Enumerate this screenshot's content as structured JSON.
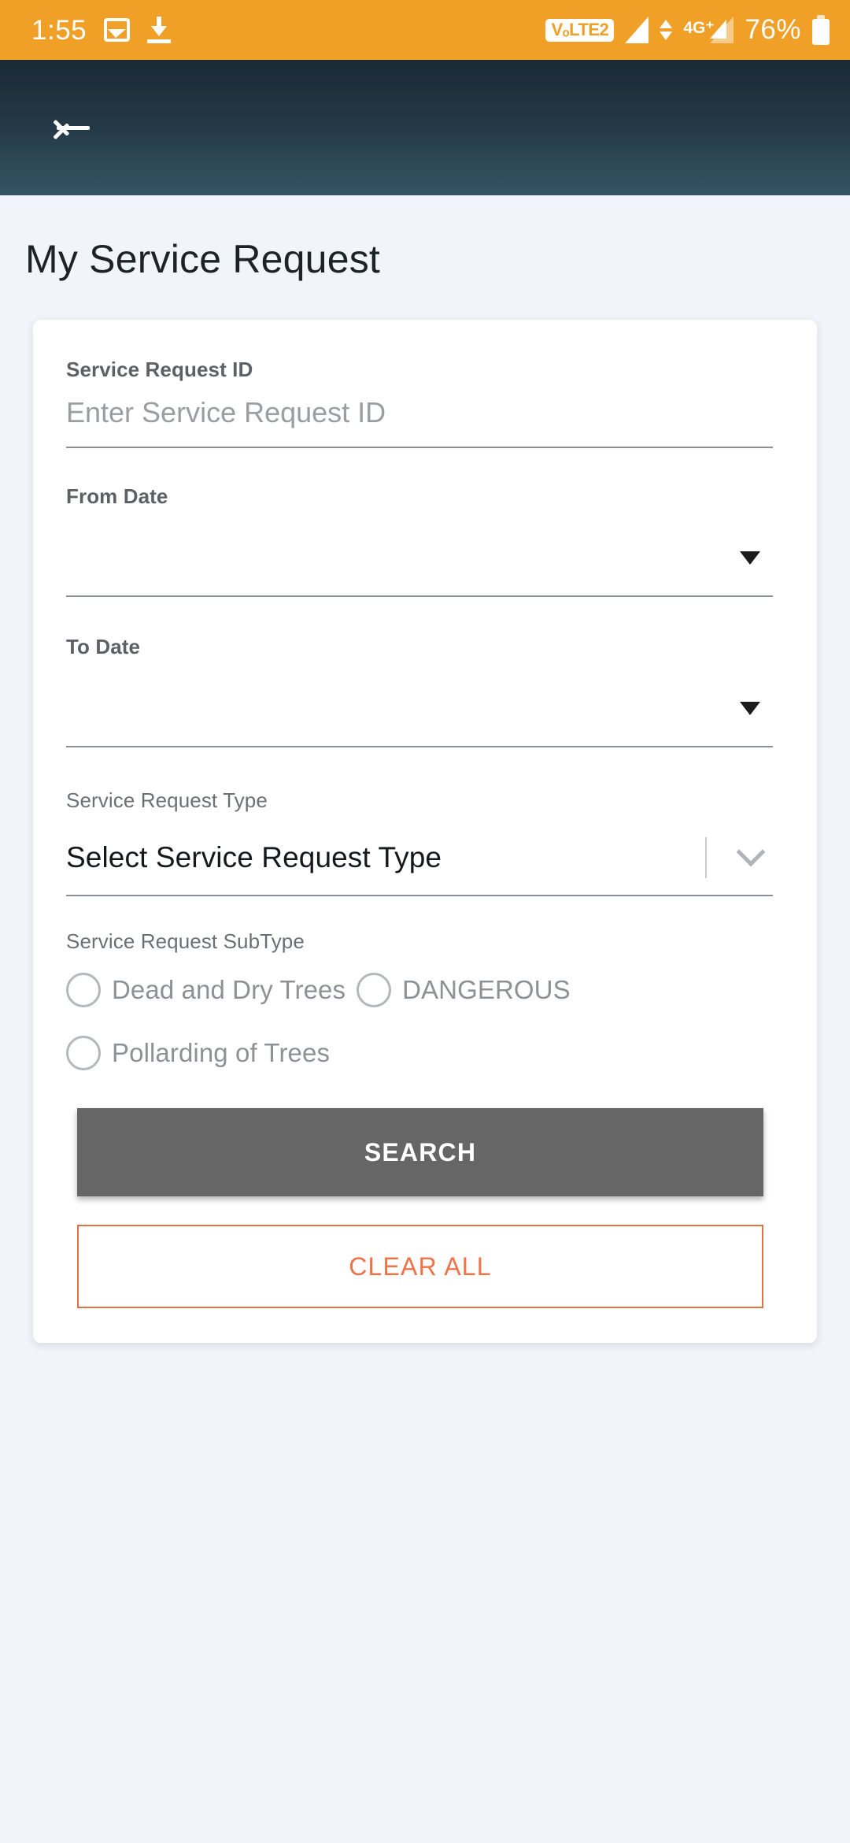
{
  "status_bar": {
    "time": "1:55",
    "image_icon": "image-icon",
    "download_icon": "download-icon",
    "volte_label": "VₒLTE2",
    "network_label": "4G⁺",
    "battery_percent": "76%",
    "background_color": "#F0A027"
  },
  "app_bar": {
    "back_icon": "arrow-left-icon",
    "gradient_from": "#1b2a35",
    "gradient_to": "#345565"
  },
  "page": {
    "title": "My Service Request",
    "background_color": "#F1F4FA"
  },
  "form": {
    "service_request_id": {
      "label": "Service Request ID",
      "placeholder": "Enter Service Request ID",
      "value": ""
    },
    "from_date": {
      "label": "From Date",
      "value": "",
      "dropdown_icon": "caret-down-icon"
    },
    "to_date": {
      "label": "To Date",
      "value": "",
      "dropdown_icon": "caret-down-icon"
    },
    "service_request_type": {
      "label": "Service Request Type",
      "selected": "Select Service Request Type",
      "dropdown_icon": "chevron-down-icon"
    },
    "service_request_subtype": {
      "label": "Service Request SubType",
      "options": [
        {
          "label": "Dead and Dry Trees",
          "selected": false
        },
        {
          "label": "DANGEROUS",
          "selected": false
        },
        {
          "label": "Pollarding of Trees",
          "selected": false
        }
      ]
    },
    "search_button": {
      "label": "SEARCH",
      "background_color": "#666666",
      "text_color": "#FFFFFF"
    },
    "clear_all_button": {
      "label": "CLEAR ALL",
      "border_color": "#E0733F",
      "text_color": "#EF7347"
    }
  }
}
